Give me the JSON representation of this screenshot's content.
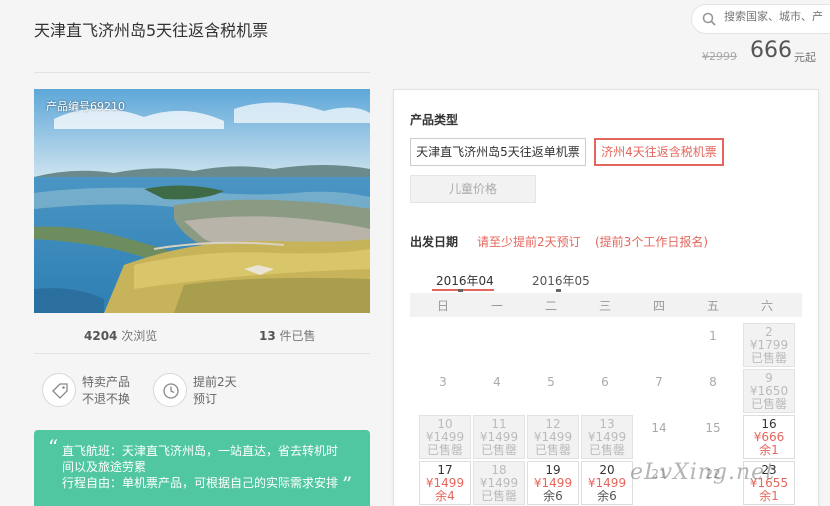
{
  "header": {
    "title": "天津直飞济州岛5天往返含税机票",
    "search_placeholder": "搜索国家、城市、产",
    "price_old": "¥2999",
    "price_now": "666",
    "price_unit": "元起"
  },
  "product": {
    "code": "产品编号69210",
    "views_count": "4204",
    "views_label": " 次浏览",
    "sold_count": "13",
    "sold_label": " 件已售",
    "features": [
      {
        "line1": "特卖产品",
        "line2": "不退不换",
        "icon": "tag-icon"
      },
      {
        "line1": "提前2天",
        "line2": "预订",
        "icon": "clock-icon"
      }
    ],
    "notice_lines": [
      "直飞航班：天津直飞济州岛，一站直达，省去转机时间以及旅途劳累",
      "行程自由：单机票产品，可根据自己的实际需求安排"
    ]
  },
  "booking": {
    "type_label": "产品类型",
    "options": [
      {
        "label": "天津直飞济州岛5天往返单机票"
      },
      {
        "label": "济州4天往返含税机票"
      },
      {
        "label": "儿童价格"
      }
    ],
    "date_label": "出发日期",
    "hint1": "请至少提前2天预订",
    "hint2": "(提前3个工作日报名)",
    "months": [
      "2016年04",
      "2016年05"
    ],
    "weekdays": [
      "日",
      "一",
      "二",
      "三",
      "四",
      "五",
      "六"
    ],
    "days": [
      {
        "date": "1",
        "price": "",
        "status": ""
      },
      {
        "date": "2",
        "price": "¥1799",
        "status": "已售罄"
      },
      {
        "date": "3",
        "price": "",
        "status": ""
      },
      {
        "date": "4",
        "price": "",
        "status": ""
      },
      {
        "date": "5",
        "price": "",
        "status": ""
      },
      {
        "date": "6",
        "price": "",
        "status": ""
      },
      {
        "date": "7",
        "price": "",
        "status": ""
      },
      {
        "date": "8",
        "price": "",
        "status": ""
      },
      {
        "date": "9",
        "price": "¥1650",
        "status": "已售罄"
      },
      {
        "date": "10",
        "price": "¥1499",
        "status": "已售罄"
      },
      {
        "date": "11",
        "price": "¥1499",
        "status": "已售罄"
      },
      {
        "date": "12",
        "price": "¥1499",
        "status": "已售罄"
      },
      {
        "date": "13",
        "price": "¥1499",
        "status": "已售罄"
      },
      {
        "date": "14",
        "price": "",
        "status": ""
      },
      {
        "date": "15",
        "price": "",
        "status": ""
      },
      {
        "date": "16",
        "price": "¥666",
        "status": "余1"
      },
      {
        "date": "17",
        "price": "¥1499",
        "status": "余4"
      },
      {
        "date": "18",
        "price": "¥1499",
        "status": "已售罄"
      },
      {
        "date": "19",
        "price": "¥1499",
        "status": "余6"
      },
      {
        "date": "20",
        "price": "¥1499",
        "status": "余6"
      },
      {
        "date": "21",
        "price": "",
        "status": ""
      },
      {
        "date": "22",
        "price": "",
        "status": ""
      },
      {
        "date": "23",
        "price": "¥1655",
        "status": "余1"
      }
    ]
  },
  "watermark": "eLvXing.net",
  "colors": {
    "accent": "#e5665c",
    "notice_bg": "#50c7a1"
  }
}
